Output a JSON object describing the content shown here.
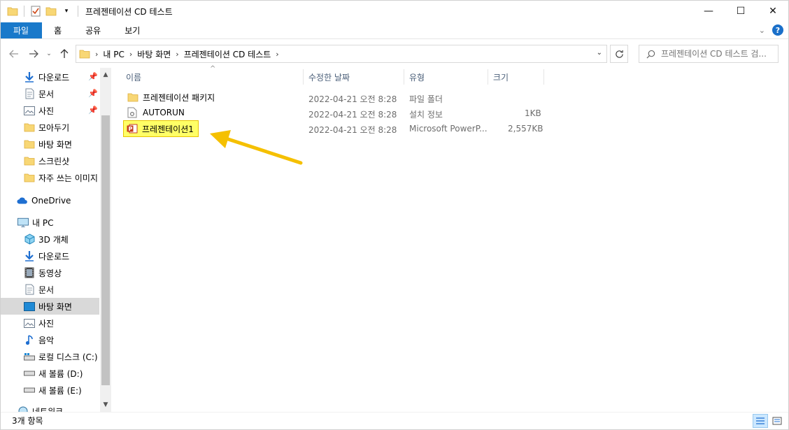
{
  "window": {
    "title": "프레젠테이션 CD 테스트",
    "minimize": "—",
    "maximize": "☐",
    "close": "✕"
  },
  "ribbon": {
    "tabs": [
      "파일",
      "홈",
      "공유",
      "보기"
    ],
    "help": "?"
  },
  "address": {
    "crumbs": [
      "내 PC",
      "바탕 화면",
      "프레젠테이션 CD 테스트"
    ],
    "search_placeholder": "프레젠테이션 CD 테스트 검..."
  },
  "sidebar": {
    "items": [
      {
        "label": "다운로드",
        "icon": "download-arrow-icon",
        "pinned": true
      },
      {
        "label": "문서",
        "icon": "document-icon",
        "pinned": true
      },
      {
        "label": "사진",
        "icon": "pictures-icon",
        "pinned": true
      },
      {
        "label": "모아두기",
        "icon": "folder-icon",
        "pinned": false
      },
      {
        "label": "바탕 화면",
        "icon": "folder-icon",
        "pinned": false
      },
      {
        "label": "스크린샷",
        "icon": "folder-icon",
        "pinned": false
      },
      {
        "label": "자주 쓰는 이미지",
        "icon": "folder-icon",
        "pinned": false
      },
      {
        "label": "OneDrive",
        "icon": "cloud-icon",
        "pinned": false
      },
      {
        "label": "내 PC",
        "icon": "computer-icon",
        "pinned": false
      },
      {
        "label": "3D 개체",
        "icon": "cube-icon",
        "pinned": false
      },
      {
        "label": "다운로드",
        "icon": "download-arrow-icon",
        "pinned": false
      },
      {
        "label": "동영상",
        "icon": "video-icon",
        "pinned": false
      },
      {
        "label": "문서",
        "icon": "document-icon",
        "pinned": false
      },
      {
        "label": "바탕 화면",
        "icon": "desktop-icon",
        "pinned": false
      },
      {
        "label": "사진",
        "icon": "pictures-icon",
        "pinned": false
      },
      {
        "label": "음악",
        "icon": "music-note-icon",
        "pinned": false
      },
      {
        "label": "로컬 디스크 (C:)",
        "icon": "drive-icon",
        "pinned": false
      },
      {
        "label": "새 볼륨 (D:)",
        "icon": "drive-icon",
        "pinned": false
      },
      {
        "label": "새 볼륨 (E:)",
        "icon": "drive-icon",
        "pinned": false
      },
      {
        "label": "네트워크",
        "icon": "network-icon",
        "pinned": false
      }
    ]
  },
  "columns": {
    "name": "이름",
    "date": "수정한 날짜",
    "type": "유형",
    "size": "크기"
  },
  "files": [
    {
      "name": "프레젠테이션 패키지",
      "date": "2022-04-21 오전 8:28",
      "type": "파일 폴더",
      "size": "",
      "icon": "folder-icon"
    },
    {
      "name": "AUTORUN",
      "date": "2022-04-21 오전 8:28",
      "type": "설치 정보",
      "size": "1KB",
      "icon": "settings-file-icon"
    },
    {
      "name": "프레젠테이션1",
      "date": "2022-04-21 오전 8:28",
      "type": "Microsoft PowerP...",
      "size": "2,557KB",
      "icon": "powerpoint-icon"
    }
  ],
  "status": {
    "count": "3개 항목"
  },
  "colors": {
    "file_tab": "#1979ca",
    "highlight": "#ffff66",
    "arrow": "#f5c000"
  }
}
